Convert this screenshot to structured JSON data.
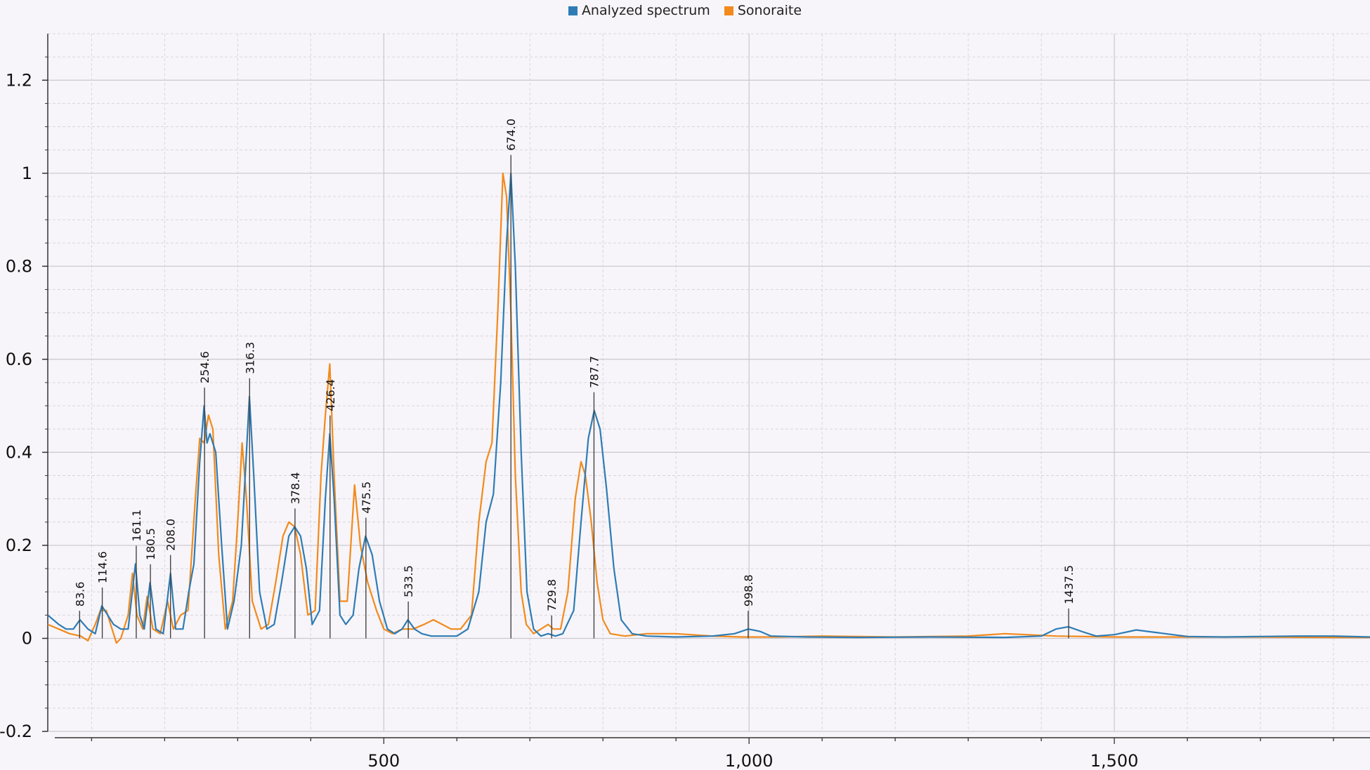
{
  "chart_data": {
    "type": "line",
    "title": "",
    "xlabel": "",
    "ylabel": "",
    "xlim": [
      40,
      1850
    ],
    "ylim": [
      -0.2,
      1.3
    ],
    "grid": true,
    "legend_position": "top-center",
    "x_ticks": [
      {
        "value": 500,
        "label": "500"
      },
      {
        "value": 1000,
        "label": "1,000"
      },
      {
        "value": 1500,
        "label": "1,500"
      }
    ],
    "y_ticks": [
      {
        "value": -0.2,
        "label": "-0.2"
      },
      {
        "value": 0,
        "label": "0"
      },
      {
        "value": 0.2,
        "label": "0.2"
      },
      {
        "value": 0.4,
        "label": "0.4"
      },
      {
        "value": 0.6,
        "label": "0.6"
      },
      {
        "value": 0.8,
        "label": "0.8"
      },
      {
        "value": 1,
        "label": "1"
      },
      {
        "value": 1.2,
        "label": "1.2"
      }
    ],
    "series": [
      {
        "name": "Analyzed spectrum",
        "color": "#2f7cb5",
        "points": [
          [
            40,
            0.05
          ],
          [
            55,
            0.03
          ],
          [
            65,
            0.02
          ],
          [
            75,
            0.02
          ],
          [
            84,
            0.04
          ],
          [
            95,
            0.02
          ],
          [
            105,
            0.01
          ],
          [
            114,
            0.07
          ],
          [
            122,
            0.05
          ],
          [
            130,
            0.03
          ],
          [
            140,
            0.02
          ],
          [
            150,
            0.02
          ],
          [
            160,
            0.16
          ],
          [
            166,
            0.05
          ],
          [
            172,
            0.02
          ],
          [
            180,
            0.12
          ],
          [
            188,
            0.02
          ],
          [
            198,
            0.01
          ],
          [
            208,
            0.14
          ],
          [
            215,
            0.02
          ],
          [
            225,
            0.02
          ],
          [
            233,
            0.1
          ],
          [
            240,
            0.16
          ],
          [
            248,
            0.38
          ],
          [
            254,
            0.5
          ],
          [
            258,
            0.42
          ],
          [
            262,
            0.44
          ],
          [
            270,
            0.4
          ],
          [
            278,
            0.2
          ],
          [
            286,
            0.02
          ],
          [
            295,
            0.08
          ],
          [
            305,
            0.2
          ],
          [
            312,
            0.4
          ],
          [
            316,
            0.52
          ],
          [
            322,
            0.35
          ],
          [
            330,
            0.1
          ],
          [
            340,
            0.02
          ],
          [
            350,
            0.03
          ],
          [
            360,
            0.12
          ],
          [
            370,
            0.22
          ],
          [
            378,
            0.24
          ],
          [
            386,
            0.22
          ],
          [
            394,
            0.15
          ],
          [
            402,
            0.03
          ],
          [
            412,
            0.06
          ],
          [
            420,
            0.3
          ],
          [
            426,
            0.44
          ],
          [
            432,
            0.3
          ],
          [
            440,
            0.05
          ],
          [
            448,
            0.03
          ],
          [
            458,
            0.05
          ],
          [
            466,
            0.15
          ],
          [
            475,
            0.22
          ],
          [
            484,
            0.18
          ],
          [
            494,
            0.08
          ],
          [
            505,
            0.02
          ],
          [
            515,
            0.01
          ],
          [
            525,
            0.02
          ],
          [
            533,
            0.04
          ],
          [
            542,
            0.02
          ],
          [
            552,
            0.01
          ],
          [
            565,
            0.005
          ],
          [
            580,
            0.005
          ],
          [
            600,
            0.005
          ],
          [
            615,
            0.02
          ],
          [
            630,
            0.1
          ],
          [
            640,
            0.25
          ],
          [
            650,
            0.31
          ],
          [
            660,
            0.55
          ],
          [
            668,
            0.85
          ],
          [
            674,
            1.0
          ],
          [
            680,
            0.8
          ],
          [
            688,
            0.4
          ],
          [
            696,
            0.1
          ],
          [
            705,
            0.02
          ],
          [
            715,
            0.005
          ],
          [
            725,
            0.01
          ],
          [
            735,
            0.005
          ],
          [
            745,
            0.01
          ],
          [
            760,
            0.06
          ],
          [
            770,
            0.25
          ],
          [
            780,
            0.43
          ],
          [
            788,
            0.49
          ],
          [
            796,
            0.45
          ],
          [
            805,
            0.32
          ],
          [
            815,
            0.15
          ],
          [
            825,
            0.04
          ],
          [
            840,
            0.01
          ],
          [
            860,
            0.005
          ],
          [
            900,
            0.003
          ],
          [
            950,
            0.005
          ],
          [
            980,
            0.01
          ],
          [
            999,
            0.02
          ],
          [
            1015,
            0.015
          ],
          [
            1030,
            0.005
          ],
          [
            1080,
            0.003
          ],
          [
            1150,
            0.002
          ],
          [
            1250,
            0.003
          ],
          [
            1350,
            0.002
          ],
          [
            1400,
            0.005
          ],
          [
            1420,
            0.02
          ],
          [
            1437,
            0.025
          ],
          [
            1455,
            0.015
          ],
          [
            1475,
            0.005
          ],
          [
            1500,
            0.008
          ],
          [
            1530,
            0.018
          ],
          [
            1560,
            0.012
          ],
          [
            1600,
            0.004
          ],
          [
            1650,
            0.003
          ],
          [
            1700,
            0.004
          ],
          [
            1750,
            0.005
          ],
          [
            1800,
            0.005
          ],
          [
            1850,
            0.003
          ]
        ]
      },
      {
        "name": "Sonoraite",
        "color": "#f28a1c",
        "points": [
          [
            40,
            0.03
          ],
          [
            55,
            0.02
          ],
          [
            70,
            0.01
          ],
          [
            85,
            0.005
          ],
          [
            95,
            -0.005
          ],
          [
            105,
            0.03
          ],
          [
            112,
            0.06
          ],
          [
            120,
            0.06
          ],
          [
            128,
            0.02
          ],
          [
            134,
            -0.01
          ],
          [
            140,
            0.0
          ],
          [
            150,
            0.05
          ],
          [
            156,
            0.14
          ],
          [
            162,
            0.05
          ],
          [
            170,
            0.02
          ],
          [
            176,
            0.09
          ],
          [
            184,
            0.02
          ],
          [
            194,
            0.01
          ],
          [
            204,
            0.08
          ],
          [
            212,
            0.02
          ],
          [
            222,
            0.05
          ],
          [
            232,
            0.06
          ],
          [
            242,
            0.3
          ],
          [
            248,
            0.43
          ],
          [
            254,
            0.42
          ],
          [
            260,
            0.48
          ],
          [
            266,
            0.45
          ],
          [
            274,
            0.18
          ],
          [
            283,
            0.02
          ],
          [
            293,
            0.08
          ],
          [
            300,
            0.25
          ],
          [
            306,
            0.42
          ],
          [
            312,
            0.3
          ],
          [
            320,
            0.08
          ],
          [
            332,
            0.02
          ],
          [
            342,
            0.03
          ],
          [
            352,
            0.12
          ],
          [
            362,
            0.22
          ],
          [
            370,
            0.25
          ],
          [
            378,
            0.24
          ],
          [
            386,
            0.18
          ],
          [
            396,
            0.05
          ],
          [
            406,
            0.06
          ],
          [
            414,
            0.35
          ],
          [
            420,
            0.48
          ],
          [
            426,
            0.59
          ],
          [
            432,
            0.35
          ],
          [
            440,
            0.08
          ],
          [
            450,
            0.08
          ],
          [
            460,
            0.33
          ],
          [
            468,
            0.2
          ],
          [
            478,
            0.12
          ],
          [
            490,
            0.06
          ],
          [
            500,
            0.02
          ],
          [
            512,
            0.01
          ],
          [
            525,
            0.02
          ],
          [
            540,
            0.02
          ],
          [
            555,
            0.03
          ],
          [
            568,
            0.04
          ],
          [
            580,
            0.03
          ],
          [
            592,
            0.02
          ],
          [
            605,
            0.02
          ],
          [
            620,
            0.05
          ],
          [
            630,
            0.25
          ],
          [
            640,
            0.38
          ],
          [
            648,
            0.42
          ],
          [
            656,
            0.7
          ],
          [
            663,
            1.0
          ],
          [
            668,
            0.95
          ],
          [
            674,
            0.7
          ],
          [
            680,
            0.35
          ],
          [
            688,
            0.1
          ],
          [
            695,
            0.03
          ],
          [
            705,
            0.01
          ],
          [
            715,
            0.02
          ],
          [
            725,
            0.03
          ],
          [
            732,
            0.02
          ],
          [
            742,
            0.02
          ],
          [
            752,
            0.1
          ],
          [
            762,
            0.3
          ],
          [
            770,
            0.38
          ],
          [
            776,
            0.35
          ],
          [
            784,
            0.25
          ],
          [
            792,
            0.12
          ],
          [
            800,
            0.04
          ],
          [
            810,
            0.01
          ],
          [
            830,
            0.005
          ],
          [
            860,
            0.01
          ],
          [
            880,
            0.01
          ],
          [
            900,
            0.01
          ],
          [
            920,
            0.008
          ],
          [
            950,
            0.005
          ],
          [
            990,
            0.003
          ],
          [
            1040,
            0.003
          ],
          [
            1100,
            0.005
          ],
          [
            1200,
            0.003
          ],
          [
            1300,
            0.005
          ],
          [
            1350,
            0.01
          ],
          [
            1380,
            0.008
          ],
          [
            1420,
            0.005
          ],
          [
            1500,
            0.003
          ],
          [
            1600,
            0.003
          ],
          [
            1700,
            0.003
          ],
          [
            1800,
            0.002
          ],
          [
            1850,
            0.002
          ]
        ]
      }
    ],
    "annotations": [
      {
        "x": 83.6,
        "y": 0.02,
        "label": "83.6"
      },
      {
        "x": 114.6,
        "y": 0.07,
        "label": "114.6"
      },
      {
        "x": 161.1,
        "y": 0.16,
        "label": "161.1"
      },
      {
        "x": 180.5,
        "y": 0.12,
        "label": "180.5"
      },
      {
        "x": 208.0,
        "y": 0.14,
        "label": "208.0"
      },
      {
        "x": 254.6,
        "y": 0.5,
        "label": "254.6"
      },
      {
        "x": 316.3,
        "y": 0.52,
        "label": "316.3"
      },
      {
        "x": 378.4,
        "y": 0.24,
        "label": "378.4"
      },
      {
        "x": 426.4,
        "y": 0.44,
        "label": "426.4"
      },
      {
        "x": 475.5,
        "y": 0.22,
        "label": "475.5"
      },
      {
        "x": 533.5,
        "y": 0.04,
        "label": "533.5"
      },
      {
        "x": 674.0,
        "y": 1.0,
        "label": "674.0"
      },
      {
        "x": 729.8,
        "y": 0.01,
        "label": "729.8"
      },
      {
        "x": 787.7,
        "y": 0.49,
        "label": "787.7"
      },
      {
        "x": 998.8,
        "y": 0.02,
        "label": "998.8"
      },
      {
        "x": 1437.5,
        "y": 0.025,
        "label": "1437.5"
      }
    ]
  }
}
